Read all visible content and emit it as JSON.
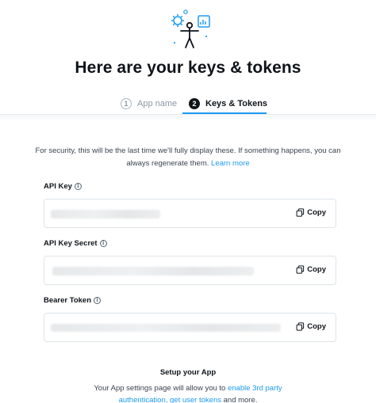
{
  "hero": {
    "title": "Here are your keys & tokens",
    "illustration_icon": "developer-figure-with-gears-icon",
    "accent_color": "#1d9bf0"
  },
  "steps": [
    {
      "number": "1",
      "label": "App name",
      "active": false
    },
    {
      "number": "2",
      "label": "Keys & Tokens",
      "active": true
    }
  ],
  "notice": {
    "text": "For security, this will be the last time we'll fully display these. If something happens, you can always regenerate them.",
    "link": "Learn more"
  },
  "fields": [
    {
      "label": "API Key",
      "value": "",
      "copy_label": "Copy",
      "masked": true
    },
    {
      "label": "API Key Secret",
      "value": "",
      "copy_label": "Copy",
      "masked": true
    },
    {
      "label": "Bearer Token",
      "value": "",
      "copy_label": "Copy",
      "masked": true
    }
  ],
  "setup": {
    "title": "Setup your App",
    "text_before": "Your App settings page will allow you to",
    "link_auth": "enable 3rd party authentication,",
    "link_tokens": "get user tokens",
    "text_after": "and more."
  }
}
